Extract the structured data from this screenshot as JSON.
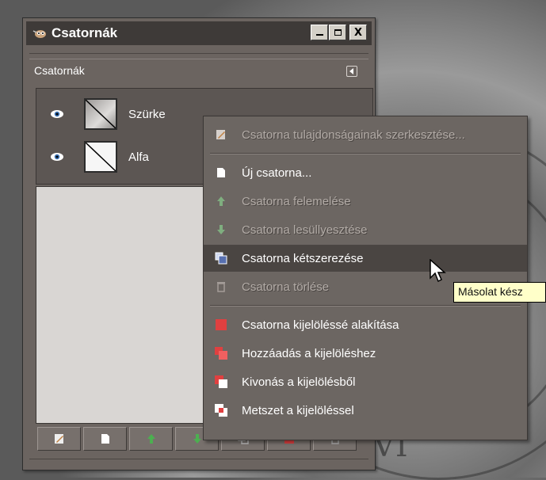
{
  "window": {
    "title": "Csatornák",
    "minimize_label": "_",
    "maximize_label": "□",
    "close_label": "X"
  },
  "panel": {
    "label": "Csatornák"
  },
  "channels": [
    {
      "name": "Szürke",
      "visible": true
    },
    {
      "name": "Alfa",
      "visible": true
    }
  ],
  "context_menu": {
    "items": [
      {
        "label": "Csatorna tulajdonságainak szerkesztése...",
        "enabled": false,
        "icon": "edit-icon"
      },
      {
        "label": "Új csatorna...",
        "enabled": true,
        "icon": "new-document-icon"
      },
      {
        "label": "Csatorna felemelése",
        "enabled": false,
        "icon": "raise-arrow-icon"
      },
      {
        "label": "Csatorna lesüllyesztése",
        "enabled": false,
        "icon": "lower-arrow-icon"
      },
      {
        "label": "Csatorna kétszerezése",
        "enabled": true,
        "icon": "duplicate-icon",
        "hovered": true
      },
      {
        "label": "Csatorna törlése",
        "enabled": false,
        "icon": "trash-icon"
      },
      {
        "label": "Csatorna kijelöléssé alakítása",
        "enabled": true,
        "icon": "selection-icon"
      },
      {
        "label": "Hozzáadás a kijelöléshez",
        "enabled": true,
        "icon": "add-selection-icon"
      },
      {
        "label": "Kivonás a kijelölésből",
        "enabled": true,
        "icon": "subtract-selection-icon"
      },
      {
        "label": "Metszet a kijelöléssel",
        "enabled": true,
        "icon": "intersect-selection-icon"
      }
    ]
  },
  "tooltip": {
    "text": "Másolat kész"
  },
  "toolbar": {
    "buttons": [
      "edit-icon",
      "new-document-icon",
      "raise-arrow-icon",
      "lower-arrow-icon",
      "duplicate-icon",
      "selection-icon",
      "trash-icon"
    ]
  },
  "colors": {
    "dock_bg": "#6b6460",
    "title_bg": "#3e3a38",
    "menu_hover": "#4a4542",
    "tooltip_bg": "#ffffc9",
    "accent_red": "#e04040",
    "accent_green": "#4caf50"
  }
}
